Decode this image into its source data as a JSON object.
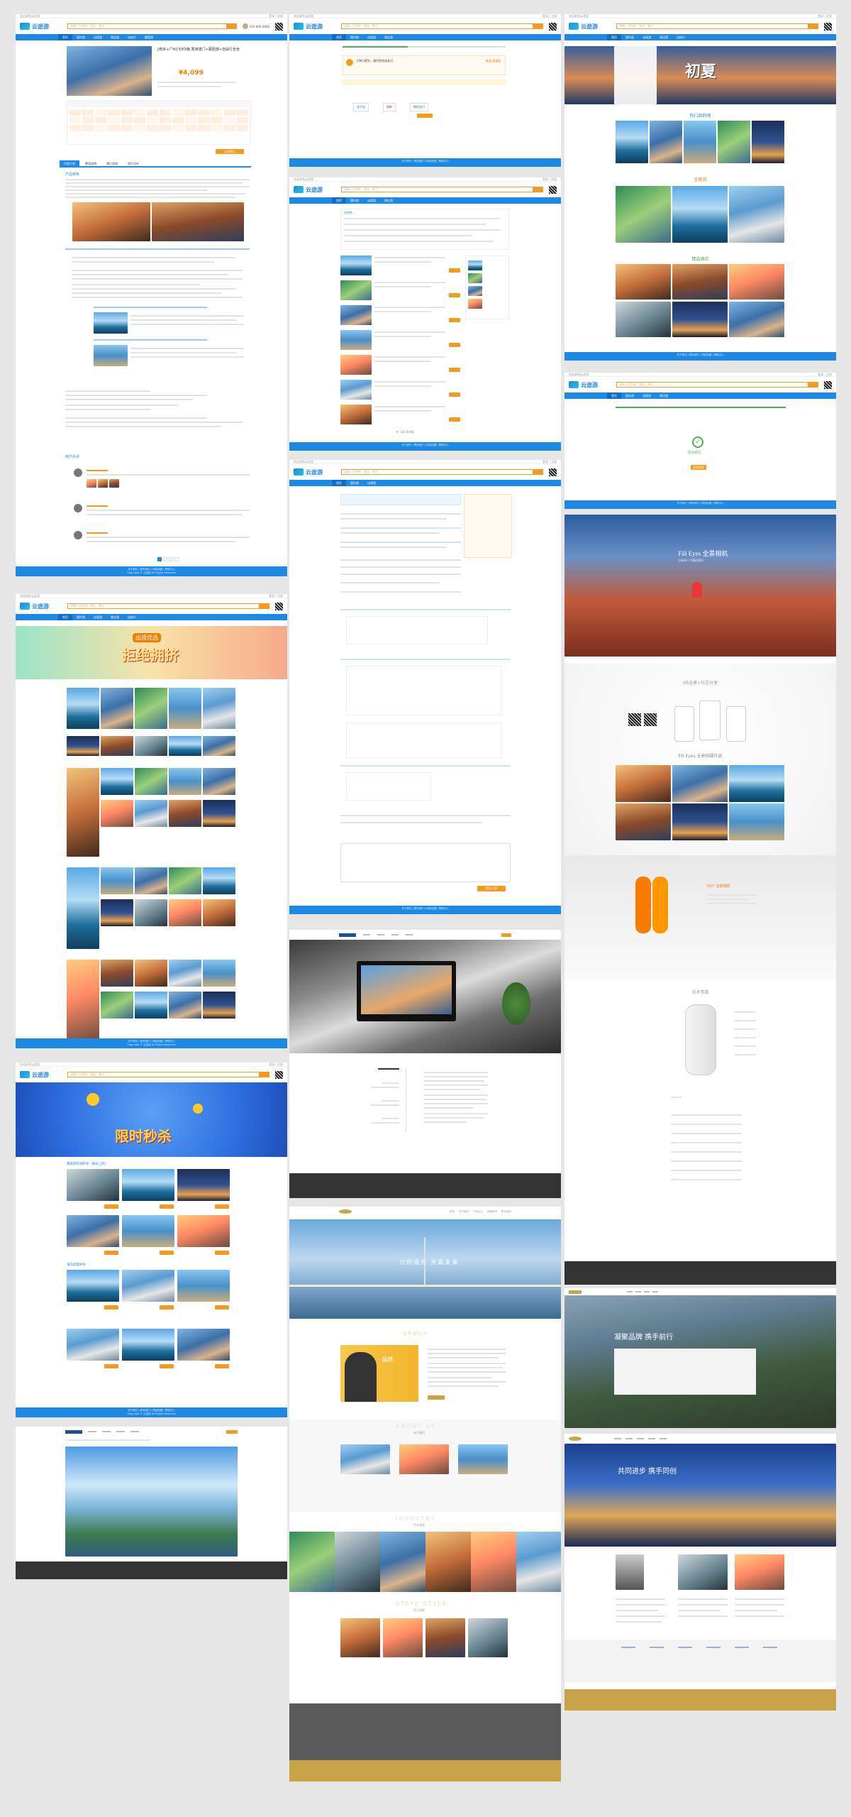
{
  "brand": {
    "logo": "云途游"
  },
  "common": {
    "hotline": "400-888-8888",
    "search_placeholder": "请输入目的地、酒店、景点",
    "nav": [
      "首页",
      "国内游",
      "出境游",
      "周边游",
      "自由行",
      "跟团游",
      "酒店",
      "门票"
    ],
    "footer_line1": "关于我们 | 联系我们 | 网站地图 | 帮助中心",
    "footer_line2": "Copyright © 云途游 All Rights Reserved"
  },
  "col1": {
    "detail": {
      "title": "[南京+广州] 6天5晚 香港澳门+跟团游+自由行全含",
      "price": "¥4,099",
      "book_label": "立即预订",
      "tabs": [
        "行程介绍",
        "费用说明",
        "预订须知",
        "用户点评"
      ],
      "section_intro": "产品特色",
      "section_reviews": "用户点评"
    },
    "topic": {
      "banner_title": "拒绝拥挤",
      "banner_sub": "出境优选"
    },
    "seckill": {
      "banner_title": "限时秒杀",
      "section_title": "精选目的地秒杀（每日上新）",
      "section2_title": "海岛度假秒杀"
    }
  },
  "col2": {
    "pay": {
      "order_text": "订单已提交，请尽快完成支付",
      "amount": "¥4,099",
      "methods": [
        "支付宝",
        "银联",
        "微信支付"
      ]
    },
    "list": {
      "filter_title": "目的地",
      "count": "共 128 条线路"
    },
    "booking": {
      "submit": "提交订单"
    },
    "corp": {
      "nav": [
        "首页",
        "关于我们",
        "产品中心",
        "新闻资讯",
        "联系我们"
      ],
      "banner_text": "力同造舟 共赢未来"
    },
    "about": {
      "title": "ABOUT US",
      "sub": "关于我们"
    },
    "industry": {
      "title": "INDUSTRY",
      "sub": "产业布局"
    },
    "staff": {
      "title": "STAFF STYLE",
      "sub": "员工风采"
    }
  },
  "col3": {
    "promo": {
      "headline": "初夏",
      "sub": "热门推荐",
      "hot_dest": "热门目的地",
      "themes": "主题游",
      "hotels": "精选酒店"
    },
    "success": {
      "text": "支付成功",
      "btn": "返回首页"
    },
    "product": {
      "hero_title": "Fill Eyes 全景相机",
      "hero_sub": "记录每一个精彩瞬间",
      "app_title": "VR全景+社交分享",
      "gallery_title": "Fill Eyes 全景拍摄作品",
      "spec_title": "720° 全景相机",
      "params_title": "技术参数"
    },
    "group": {
      "hero_text": "凝聚品牌 携手前行",
      "hero2_text": "共同进步 携手同创"
    }
  }
}
